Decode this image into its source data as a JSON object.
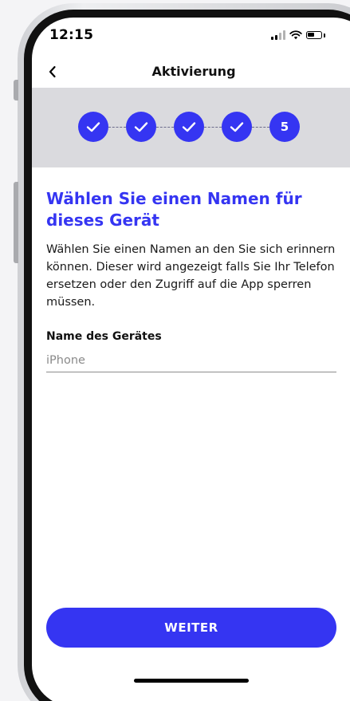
{
  "status_bar": {
    "time": "12:15",
    "icons": [
      "signal-icon",
      "wifi-icon",
      "battery-icon"
    ]
  },
  "nav": {
    "back_icon": "chevron-left-icon",
    "title": "Aktivierung"
  },
  "stepper": {
    "steps": [
      {
        "state": "completed",
        "icon": "checkmark-icon"
      },
      {
        "state": "completed",
        "icon": "checkmark-icon"
      },
      {
        "state": "completed",
        "icon": "checkmark-icon"
      },
      {
        "state": "completed",
        "icon": "checkmark-icon"
      },
      {
        "state": "current",
        "label": "5"
      }
    ],
    "current_step": 5,
    "total_steps": 5
  },
  "main": {
    "headline": "Wählen Sie einen Namen für dieses Gerät",
    "description": "Wählen Sie einen Namen an den Sie sich erinnern können. Dieser wird angezeigt falls Sie Ihr Telefon ersetzen oder den Zugriff auf die App sperren müssen.",
    "field_label": "Name des Gerätes",
    "device_name_placeholder": "iPhone",
    "device_name_value": ""
  },
  "actions": {
    "continue_label": "WEITER"
  },
  "colors": {
    "accent": "#3535F2",
    "stepper_band": "#DADADE",
    "background": "#FFFFFF",
    "text": "#1A1A1A"
  }
}
